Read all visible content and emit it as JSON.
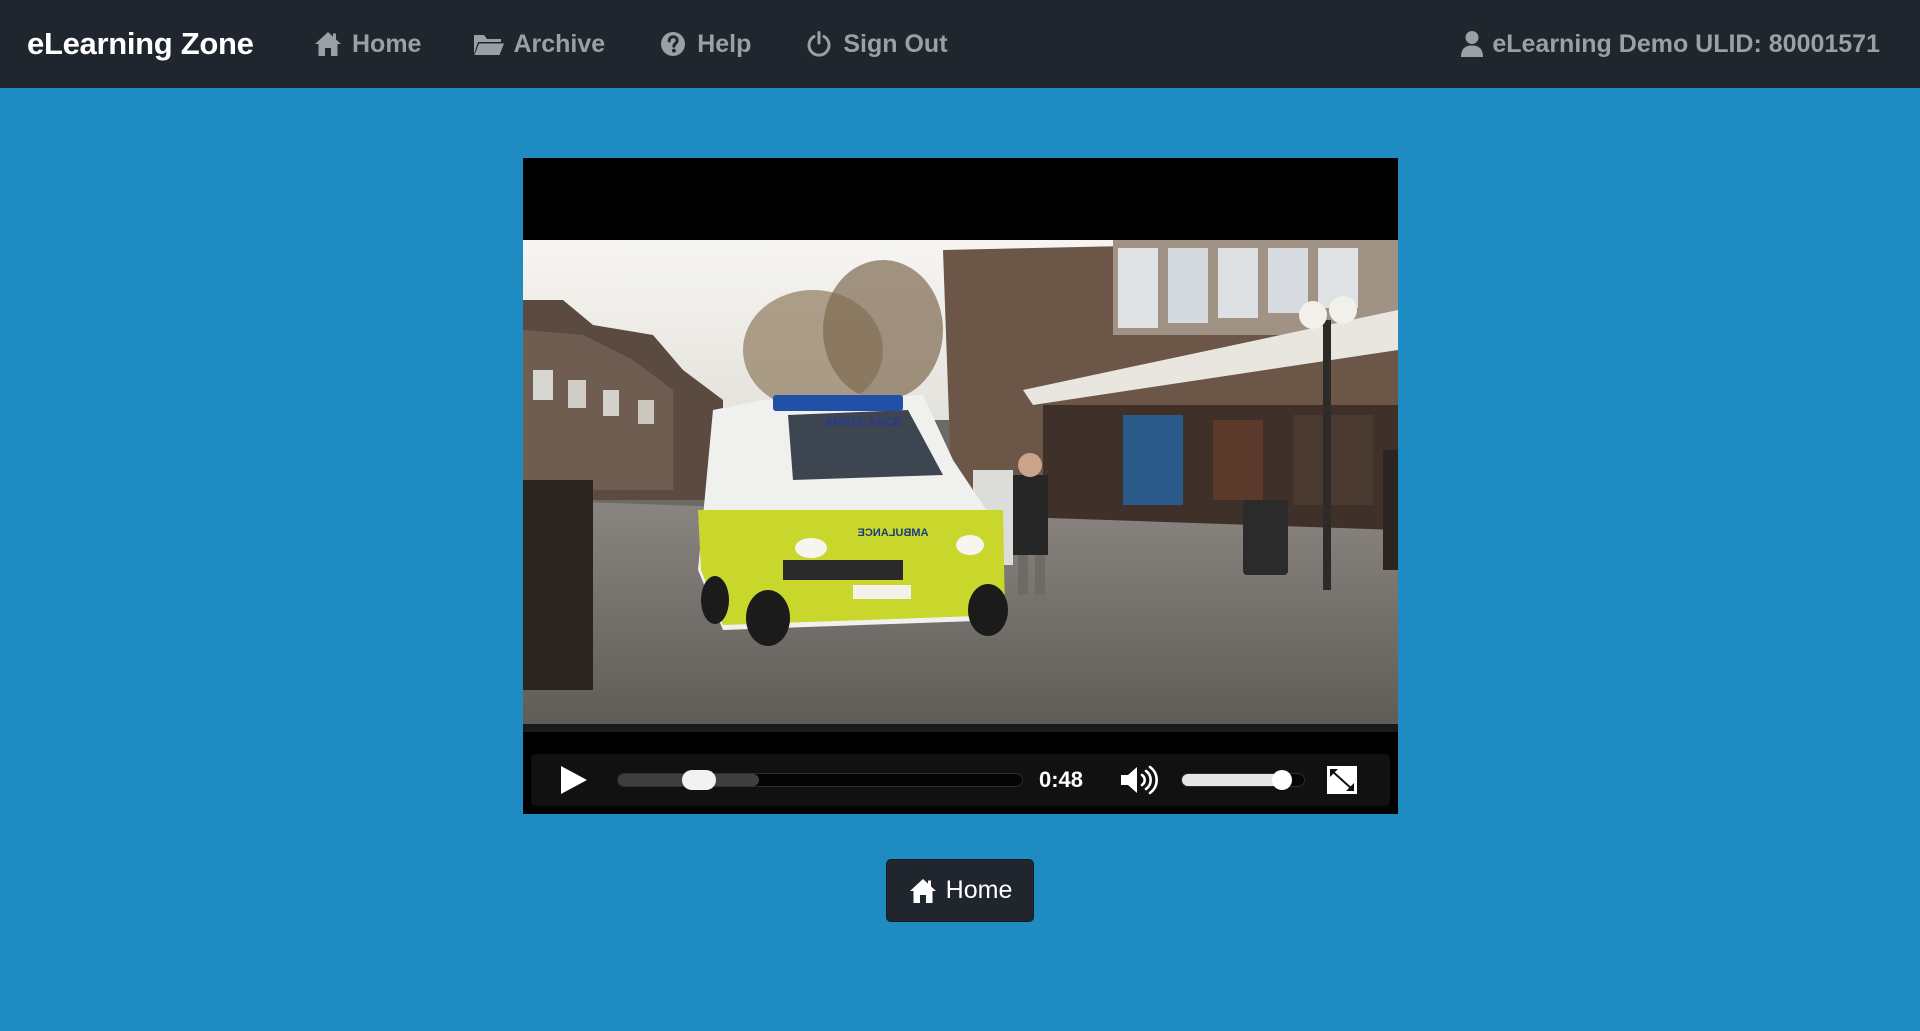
{
  "app": {
    "brand": "eLearning Zone"
  },
  "nav": {
    "items": [
      {
        "label": "Home",
        "icon": "home-icon"
      },
      {
        "label": "Archive",
        "icon": "folder-open-icon"
      },
      {
        "label": "Help",
        "icon": "question-circle-icon"
      },
      {
        "label": "Sign Out",
        "icon": "power-icon"
      }
    ],
    "user": {
      "label": "eLearning Demo ULID: 80001571",
      "icon": "user-icon"
    }
  },
  "player": {
    "time": "0:48",
    "progress_fraction": 0.2,
    "buffered_fraction": 0.35,
    "volume_fraction": 0.82,
    "video_scene": {
      "vehicle_marking_front": "AMBULANCE",
      "vehicle_marking_bonnet": "AMBULANCE"
    }
  },
  "home_button": {
    "label": "Home",
    "icon": "home-icon"
  },
  "colors": {
    "page_background": "#1e8bc3",
    "navbar_background": "#1f262d",
    "nav_text": "#9aa0a6",
    "brand_text": "#ffffff",
    "player_background": "#000000",
    "ambulance_yellow": "#c9d62c"
  }
}
